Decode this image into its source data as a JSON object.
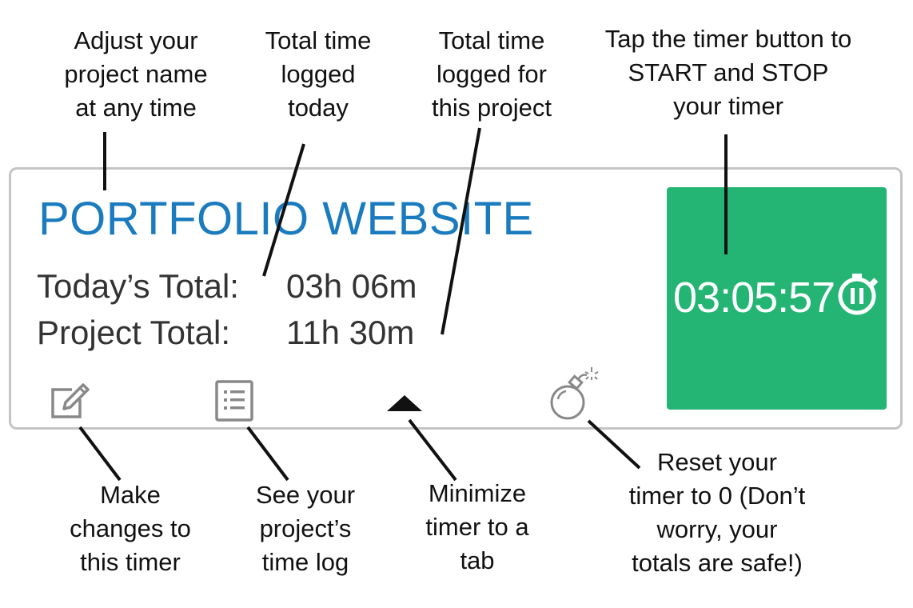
{
  "timer_card": {
    "project_name": "PORTFOLIO WEBSITE",
    "today_label": "Today’s Total:",
    "today_value": "03h 06m",
    "project_label": "Project Total:",
    "project_value": "11h 30m",
    "timer_display": "03:05:57",
    "timer_color": "#24b574",
    "project_name_color": "#1a7bbf",
    "icons": {
      "edit": "edit-icon",
      "time_log": "list-icon",
      "minimize": "triangle-up-icon",
      "reset": "bomb-icon",
      "timer_state": "pause-stopwatch-icon"
    }
  },
  "annotations": {
    "project_name": "Adjust your\nproject name\nat any time",
    "today_total": "Total time\nlogged\ntoday",
    "project_total": "Total time\nlogged for\nthis project",
    "timer_button": "Tap the timer button to\nSTART and STOP\nyour timer",
    "edit": "Make\nchanges to\nthis timer",
    "time_log": "See your\nproject’s\ntime log",
    "minimize": "Minimize\ntimer to a\ntab",
    "reset": "Reset your\ntimer to 0 (Don’t\nworry, your\ntotals are safe!)"
  }
}
